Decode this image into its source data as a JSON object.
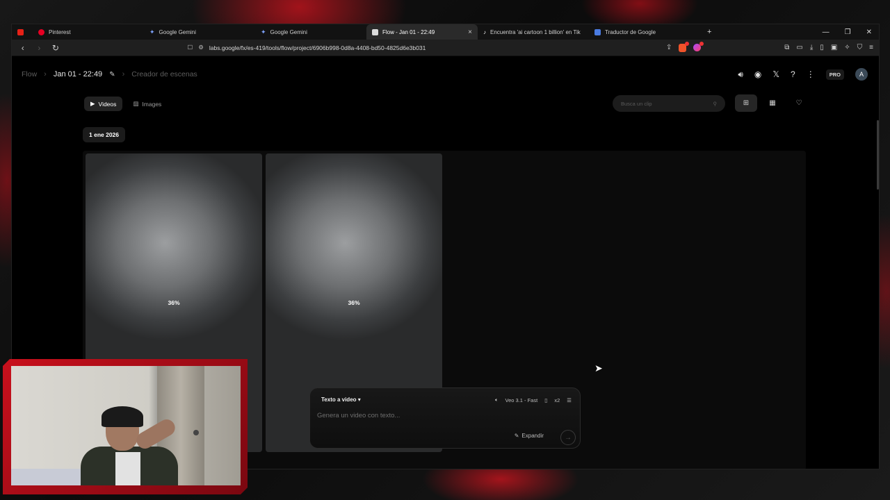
{
  "tabs": [
    {
      "label": "",
      "favicon": "youtube-icon",
      "active": false
    },
    {
      "label": "Pinterest",
      "favicon": "pinterest-icon",
      "active": false
    },
    {
      "label": "Google Gemini",
      "favicon": "gemini-icon",
      "active": false
    },
    {
      "label": "Google Gemini",
      "favicon": "gemini-icon",
      "active": false
    },
    {
      "label": "Flow - Jan 01 - 22:49",
      "favicon": "flow-icon",
      "active": true
    },
    {
      "label": "Encuentra 'ai cartoon 1 billion' en Tik",
      "favicon": "tiktok-icon",
      "active": false
    },
    {
      "label": "Traductor de Google",
      "favicon": "translate-icon",
      "active": false
    }
  ],
  "browser": {
    "url": "labs.google/fx/es-419/tools/flow/project/6906b998-0d8a-4408-bd50-4825d6e3b031",
    "new_tab": "+",
    "close_tab": "×"
  },
  "breadcrumb": {
    "root": "Flow",
    "project": "Jan 01 - 22:49",
    "section": "Creador de escenas"
  },
  "header": {
    "pro_badge": "PRO",
    "avatar_initial": "A"
  },
  "media_tabs": {
    "videos": "Videos",
    "images": "Images"
  },
  "search": {
    "placeholder": "Busca un clip"
  },
  "date_group": "1 ene 2026",
  "cards": [
    {
      "progress_label": "36%",
      "progress": 0.36
    },
    {
      "progress_label": "36%",
      "progress": 0.36
    }
  ],
  "composer": {
    "mode": "Texto a video",
    "model": "Veo 3.1 - Fast",
    "count": "x2",
    "placeholder": "Genera un video con texto...",
    "expand": "Expandir"
  },
  "colors": {
    "accent_red": "#c8101c",
    "background": "#000000"
  }
}
